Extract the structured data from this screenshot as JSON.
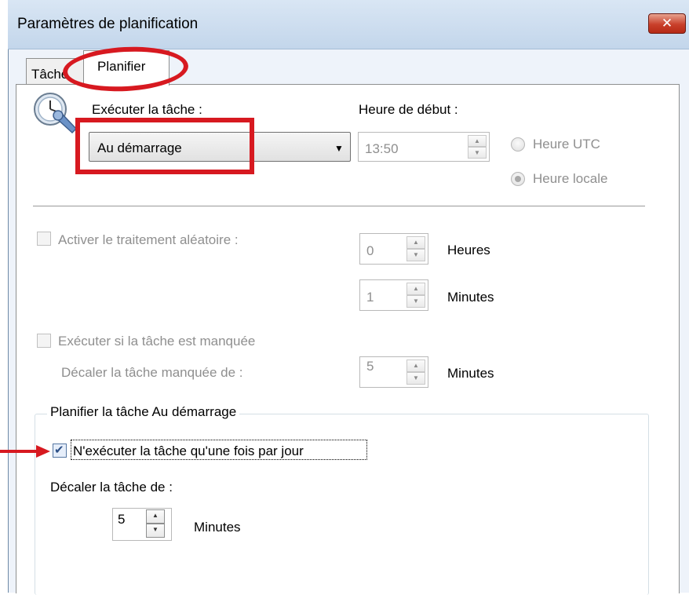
{
  "window": {
    "title": "Paramètres de planification",
    "close_glyph": "✕"
  },
  "tabs": [
    {
      "label": "Tâche",
      "selected": false
    },
    {
      "label": "Planifier",
      "selected": true
    }
  ],
  "schedule": {
    "run_label": "Exécuter la tâche :",
    "run_value": "Au démarrage",
    "start_time_label": "Heure de début :",
    "start_time_value": "13:50",
    "utc_label": "Heure UTC",
    "local_label": "Heure locale",
    "selected_time_mode": "Heure locale"
  },
  "randomize": {
    "checkbox_label": "Activer le traitement aléatoire :",
    "checked": false,
    "hours_value": "0",
    "hours_unit": "Heures",
    "minutes_value": "1",
    "minutes_unit": "Minutes"
  },
  "missed": {
    "checkbox_label": "Exécuter si la tâche est manquée",
    "checked": false,
    "delay_label": "Décaler la tâche manquée de :",
    "delay_value": "5",
    "delay_unit": "Minutes"
  },
  "startup_group": {
    "title": "Planifier la tâche Au démarrage",
    "once_label": "N'exécuter la tâche qu'une fois par jour",
    "once_checked": true,
    "delay_label": "Décaler la tâche de :",
    "delay_value": "5",
    "delay_unit": "Minutes"
  },
  "annotations": {
    "highlight_color": "#d71920"
  },
  "icons": {
    "clock": "clock-icon",
    "dropdown": "chevron-down-icon",
    "spin_up": "▲",
    "spin_down": "▼"
  }
}
